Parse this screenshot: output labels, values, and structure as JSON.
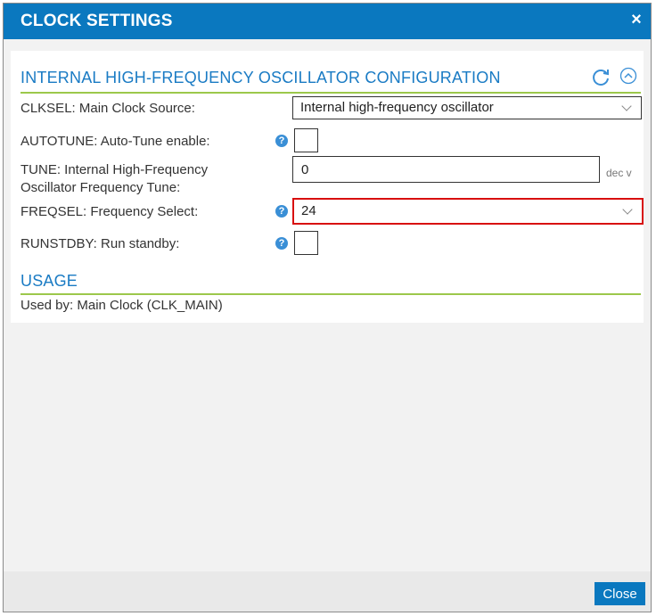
{
  "dialog": {
    "title": "CLOCK SETTINGS",
    "close_glyph": "×",
    "footer_close_label": "Close"
  },
  "config_section": {
    "title": "INTERNAL HIGH-FREQUENCY OSCILLATOR CONFIGURATION",
    "refresh_icon": "refresh-icon",
    "collapse_icon": "collapse-up-icon"
  },
  "fields": {
    "clksel": {
      "label": "CLKSEL: Main Clock Source:",
      "value": "Internal high-frequency oscillator"
    },
    "autotune": {
      "label": "AUTOTUNE: Auto-Tune enable:",
      "checked": false
    },
    "tune": {
      "label_line1": "TUNE: Internal High-Frequency",
      "label_line2": "Oscillator Frequency Tune:",
      "value": "0",
      "unit": "dec v"
    },
    "freqsel": {
      "label": "FREQSEL: Frequency Select:",
      "value": "24"
    },
    "runstdby": {
      "label": "RUNSTDBY: Run standby:",
      "checked": false
    },
    "help_glyph": "?"
  },
  "usage_section": {
    "title": "USAGE",
    "text": "Used by: Main Clock (CLK_MAIN)"
  },
  "colors": {
    "titlebar": "#0a78bf",
    "section_title": "#1a7bc4",
    "divider": "#9cc84b",
    "highlight": "#d80f0f"
  }
}
